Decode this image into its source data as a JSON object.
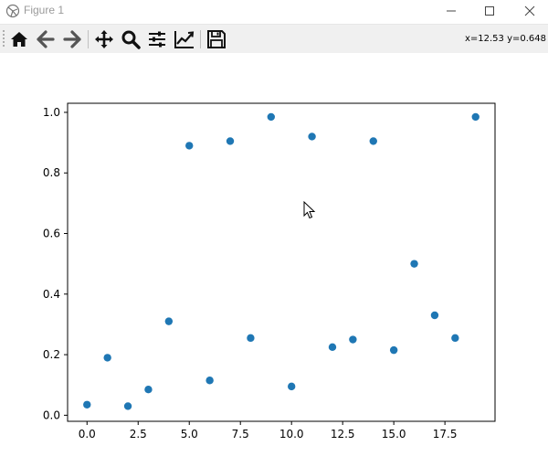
{
  "window": {
    "title": "Figure 1",
    "icon": "matplotlib-figure-icon",
    "controls": [
      "minimize-icon",
      "maximize-icon",
      "close-icon"
    ]
  },
  "toolbar": {
    "buttons": [
      {
        "icon": "home-icon",
        "tooltip": "Reset original view"
      },
      {
        "icon": "back-arrow-icon",
        "tooltip": "Back"
      },
      {
        "icon": "forward-arrow-icon",
        "tooltip": "Forward"
      },
      {
        "icon": "pan-move-icon",
        "tooltip": "Pan"
      },
      {
        "icon": "zoom-magnifier-icon",
        "tooltip": "Zoom"
      },
      {
        "icon": "subplots-sliders-icon",
        "tooltip": "Configure subplots"
      },
      {
        "icon": "edit-axis-icon",
        "tooltip": "Edit axis"
      },
      {
        "icon": "save-floppy-icon",
        "tooltip": "Save"
      }
    ],
    "coordinates": "x=12.53 y=0.648"
  },
  "colors": {
    "marker": "#1f77b4",
    "toolbar_bg": "#f0f0f0",
    "title_text": "#9a9a9a"
  },
  "chart_data": {
    "type": "scatter",
    "x": [
      0,
      1,
      2,
      3,
      4,
      5,
      6,
      7,
      8,
      9,
      10,
      11,
      12,
      13,
      14,
      15,
      16,
      17,
      18,
      19
    ],
    "y": [
      0.035,
      0.19,
      0.03,
      0.085,
      0.31,
      0.89,
      0.115,
      0.905,
      0.255,
      0.985,
      0.095,
      0.92,
      0.225,
      0.25,
      0.905,
      0.215,
      0.5,
      0.33,
      0.255,
      0.985
    ],
    "xlim": [
      -0.95,
      19.95
    ],
    "ylim": [
      -0.02,
      1.03
    ],
    "xticks": [
      0.0,
      2.5,
      5.0,
      7.5,
      10.0,
      12.5,
      15.0,
      17.5
    ],
    "xtick_labels": [
      "0.0",
      "2.5",
      "5.0",
      "7.5",
      "10.0",
      "12.5",
      "15.0",
      "17.5"
    ],
    "yticks": [
      0.0,
      0.2,
      0.4,
      0.6,
      0.8,
      1.0
    ],
    "ytick_labels": [
      "0.0",
      "0.2",
      "0.4",
      "0.6",
      "0.8",
      "1.0"
    ],
    "grid": false,
    "title": "",
    "xlabel": "",
    "ylabel": ""
  }
}
